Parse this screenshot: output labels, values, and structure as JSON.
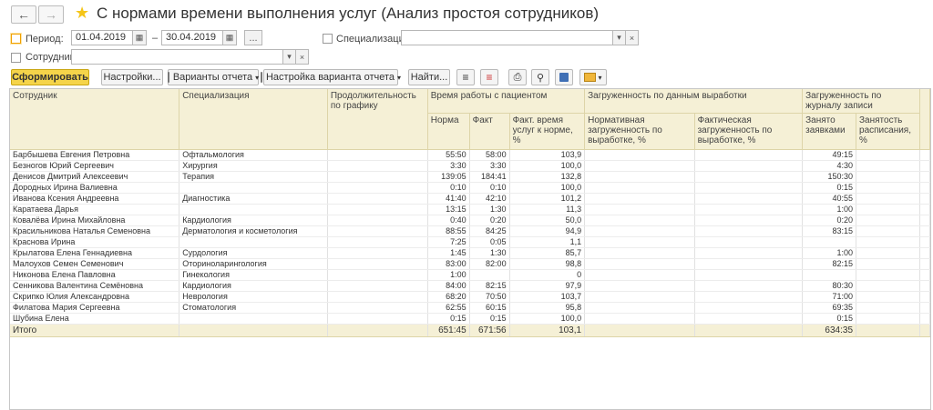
{
  "header": {
    "title": "С нормами времени выполнения услуг (Анализ простоя сотрудников)"
  },
  "filters": {
    "period_label": "Период:",
    "date_from": "01.04.2019",
    "date_sep": "–",
    "date_to": "30.04.2019",
    "more_btn": "...",
    "spec_label": "Специализация:",
    "spec_value": "",
    "employee_label": "Сотрудник:",
    "employee_value": ""
  },
  "toolbar": {
    "generate": "Сформировать",
    "settings": "Настройки...",
    "variants": "Варианты отчета",
    "variant_settings": "Настройка варианта отчета",
    "find": "Найти..."
  },
  "table": {
    "headers": {
      "employee": "Сотрудник",
      "spec": "Специализация",
      "duration": "Продолжительность по графику",
      "work_time": "Время работы с пациентом",
      "norm": "Норма",
      "fact": "Факт",
      "fact_pct": "Факт. время услуг к норме, %",
      "load_output": "Загруженность по данным выработки",
      "norm_load": "Нормативная загруженность по выработке, %",
      "fact_load": "Фактическая загруженность по выработке, %",
      "load_journal": "Загруженность по журналу записи",
      "busy": "Занято заявками",
      "schedule_pct": "Занятость расписания, %"
    },
    "rows": [
      {
        "name": "Барбышева Евгения Петровна",
        "spec": "Офтальмология",
        "norm": "55:50",
        "fact": "58:00",
        "pct": "103,9",
        "busy": "49:15"
      },
      {
        "name": "Безногов Юрий Сергеевич",
        "spec": "Хирургия",
        "norm": "3:30",
        "fact": "3:30",
        "pct": "100,0",
        "busy": "4:30"
      },
      {
        "name": "Денисов Дмитрий Алексеевич",
        "spec": "Терапия",
        "norm": "139:05",
        "fact": "184:41",
        "pct": "132,8",
        "busy": "150:30"
      },
      {
        "name": "Дородных Ирина Валиевна",
        "spec": "",
        "norm": "0:10",
        "fact": "0:10",
        "pct": "100,0",
        "busy": "0:15"
      },
      {
        "name": "Иванова Ксения Андреевна",
        "spec": "Диагностика",
        "norm": "41:40",
        "fact": "42:10",
        "pct": "101,2",
        "busy": "40:55"
      },
      {
        "name": "Каратаева Дарья",
        "spec": "",
        "norm": "13:15",
        "fact": "1:30",
        "pct": "11,3",
        "busy": "1:00"
      },
      {
        "name": "Ковалёва Ирина Михайловна",
        "spec": "Кардиология",
        "norm": "0:40",
        "fact": "0:20",
        "pct": "50,0",
        "busy": "0:20"
      },
      {
        "name": "Красильникова Наталья Семеновна",
        "spec": "Дерматология и косметология",
        "norm": "88:55",
        "fact": "84:25",
        "pct": "94,9",
        "busy": "83:15"
      },
      {
        "name": "Краснова Ирина",
        "spec": "",
        "norm": "7:25",
        "fact": "0:05",
        "pct": "1,1",
        "busy": ""
      },
      {
        "name": "Крылатова Елена Геннадиевна",
        "spec": "Сурдология",
        "norm": "1:45",
        "fact": "1:30",
        "pct": "85,7",
        "busy": "1:00"
      },
      {
        "name": "Малоухов Семен Семенович",
        "spec": "Оториноларингология",
        "norm": "83:00",
        "fact": "82:00",
        "pct": "98,8",
        "busy": "82:15"
      },
      {
        "name": "Никонова Елена Павловна",
        "spec": "Гинекология",
        "norm": "1:00",
        "fact": "",
        "pct": "0",
        "busy": ""
      },
      {
        "name": "Сенникова Валентина Семёновна",
        "spec": "Кардиология",
        "norm": "84:00",
        "fact": "82:15",
        "pct": "97,9",
        "busy": "80:30"
      },
      {
        "name": "Скрипко Юлия Александровна",
        "spec": "Неврология",
        "norm": "68:20",
        "fact": "70:50",
        "pct": "103,7",
        "busy": "71:00"
      },
      {
        "name": "Филатова Мария Сергеевна",
        "spec": "Стоматология",
        "norm": "62:55",
        "fact": "60:15",
        "pct": "95,8",
        "busy": "69:35"
      },
      {
        "name": "Шубина Елена",
        "spec": "",
        "norm": "0:15",
        "fact": "0:15",
        "pct": "100,0",
        "busy": "0:15"
      }
    ],
    "total": {
      "name": "Итого",
      "norm": "651:45",
      "fact": "671:56",
      "pct": "103,1",
      "busy": "634:35"
    }
  },
  "colors": {
    "accent": "#f5d44a",
    "header_bg": "#f5f0d6",
    "star": "#f5c518"
  }
}
